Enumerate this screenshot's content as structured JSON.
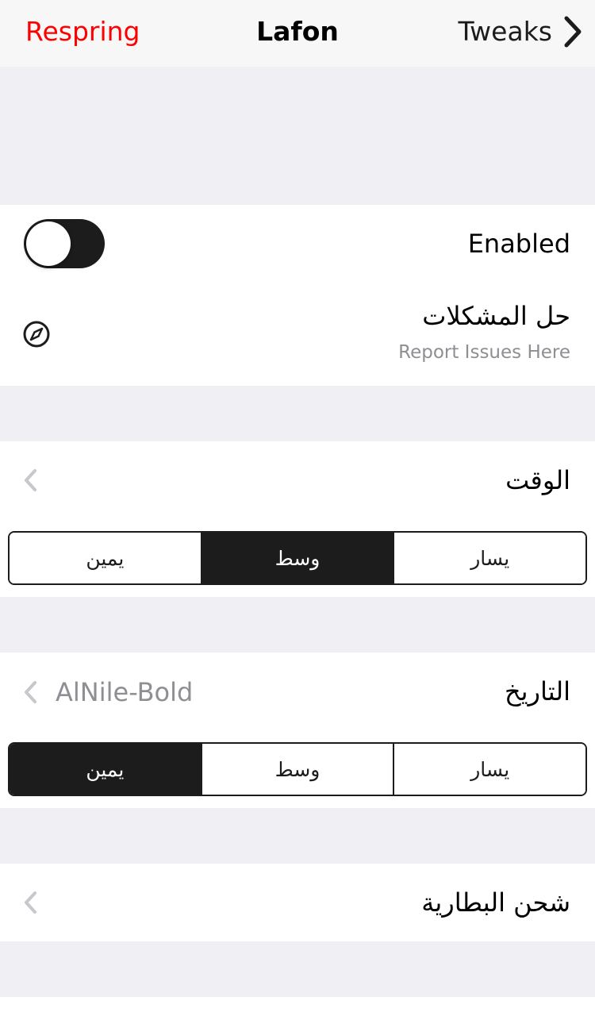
{
  "navbar": {
    "left_label": "Respring",
    "title": "Lafon",
    "right_label": "Tweaks",
    "accent_color": "#ff0000"
  },
  "main": {
    "enabled_label": "Enabled",
    "enabled_value": false,
    "support": {
      "label": "حل المشكلات",
      "sublabel": "Report Issues Here",
      "icon": "compass-icon"
    },
    "time": {
      "label": "الوقت",
      "segments": [
        "يمين",
        "وسط",
        "يسار"
      ],
      "selected": "وسط"
    },
    "date": {
      "label": "التاريخ",
      "value": "AlNile-Bold",
      "segments": [
        "يمين",
        "وسط",
        "يسار"
      ],
      "selected": "يمين"
    },
    "battery": {
      "label": "شحن البطارية"
    }
  },
  "colors": {
    "background": "#efeff4",
    "cell": "#ffffff",
    "control": "#1c1c1c",
    "secondary_text": "#8e8e93"
  }
}
